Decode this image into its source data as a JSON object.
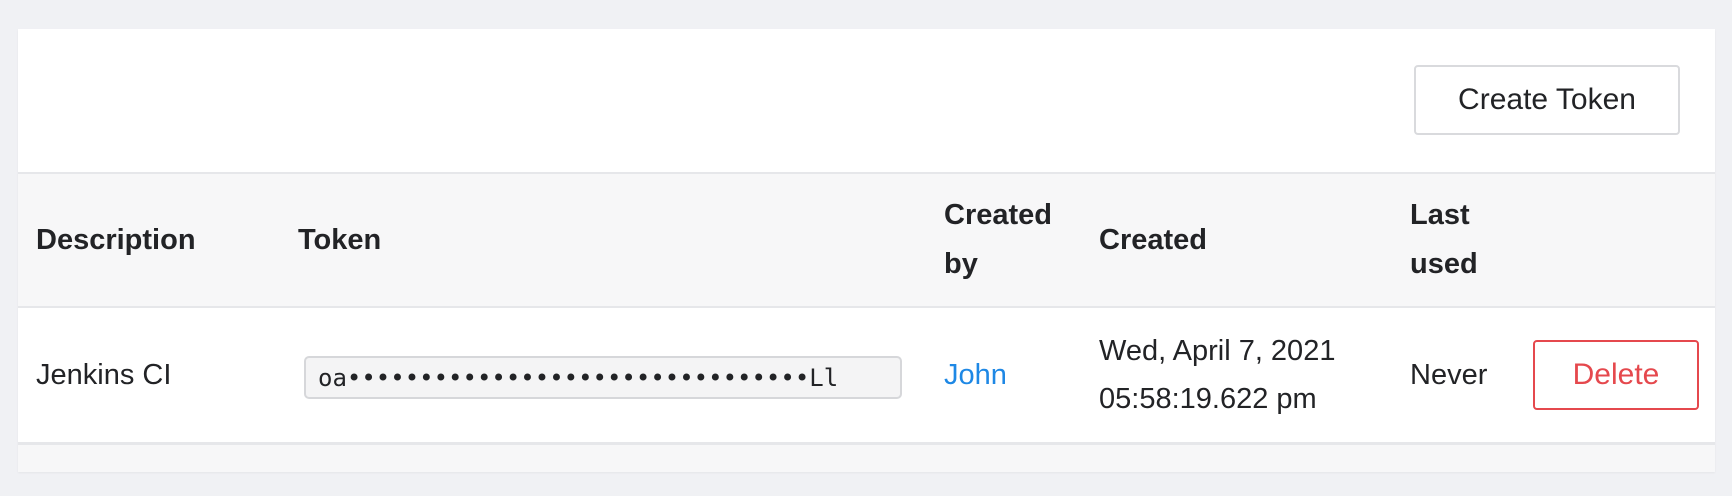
{
  "toolbar": {
    "create_label": "Create Token"
  },
  "table": {
    "columns": {
      "description": "Description",
      "token": "Token",
      "created_by_line1": "Created",
      "created_by_line2": "by",
      "created": "Created",
      "last_used_line1": "Last",
      "last_used_line2": "used"
    },
    "rows": [
      {
        "description": "Jenkins CI",
        "token": "oa••••••••••••••••••••••••••••••••Ll",
        "created_by": "John",
        "created_line1": "Wed, April 7, 2021",
        "created_line2": "05:58:19.622 pm",
        "last_used": "Never",
        "delete_label": "Delete"
      }
    ]
  },
  "colors": {
    "link": "#1e88e5",
    "danger": "#e5484d",
    "header_bg": "#f7f7f8",
    "page_bg": "#f0f1f4"
  }
}
